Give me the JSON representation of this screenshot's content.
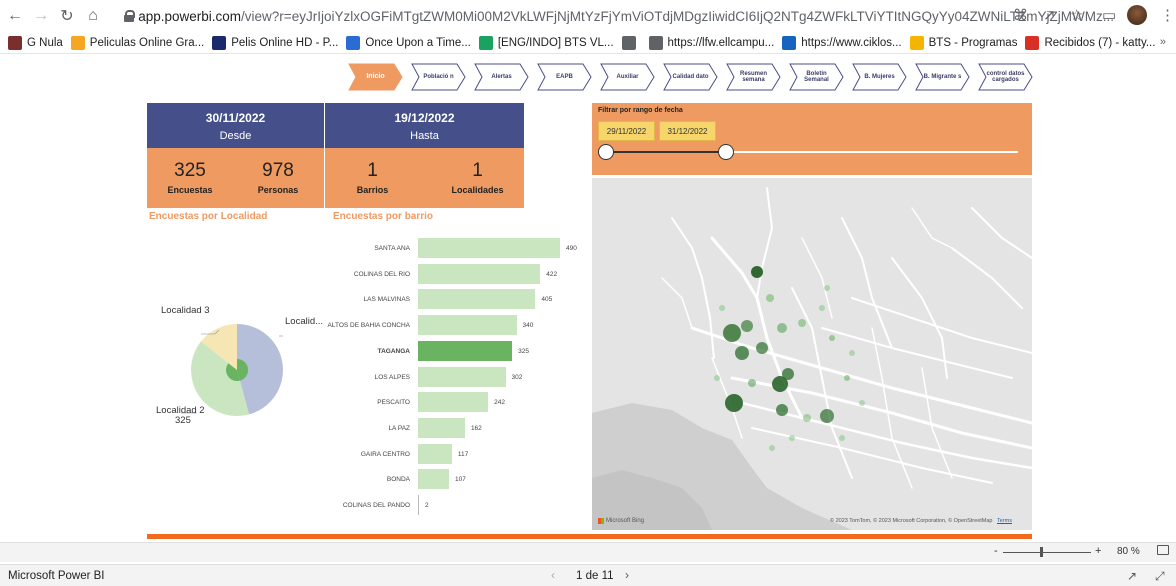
{
  "browser": {
    "url_host": "app.powerbi.com",
    "url_path": "/view?r=eyJrIjoiYzlxOGFiMTgtZWM0Mi00M2VkLWFjNjMtYzFjYmViOTdjMDgzIiwidCI6IjQ2NTg4ZWFkLTViYTItNGQyYy04ZWNiLTZmYjZjMWMz...",
    "bookmarks": [
      {
        "label": "G Nula",
        "icon": "gnula-icon",
        "color": "#7a2e2e"
      },
      {
        "label": "Peliculas Online Gra...",
        "icon": "88-icon",
        "color": "#f5a623"
      },
      {
        "label": "Pelis Online HD - P...",
        "icon": "hd-icon",
        "color": "#1a2a6c"
      },
      {
        "label": "Once Upon a Time...",
        "icon": "s-icon",
        "color": "#2b6cd4"
      },
      {
        "label": "[ENG/INDO] BTS VL...",
        "icon": "plus-icon",
        "color": "#1aa260"
      },
      {
        "label": "",
        "icon": "globe-icon",
        "color": "#5f6368"
      },
      {
        "label": "https://lfw.ellcampu...",
        "icon": "globe-icon",
        "color": "#5f6368"
      },
      {
        "label": "https://www.ciklos...",
        "icon": "c-icon",
        "color": "#1565c0"
      },
      {
        "label": "BTS - Programas",
        "icon": "drive-icon",
        "color": "#f4b400"
      },
      {
        "label": "Recibidos (7) - katty...",
        "icon": "gmail-icon",
        "color": "#d93025"
      }
    ]
  },
  "nav": [
    {
      "label": "Inicio",
      "active": true
    },
    {
      "label": "Població n",
      "active": false
    },
    {
      "label": "Alertas",
      "active": false
    },
    {
      "label": "EAPB",
      "active": false
    },
    {
      "label": "Auxiliar",
      "active": false
    },
    {
      "label": "Calidad dato",
      "active": false
    },
    {
      "label": "Resumen semana",
      "active": false
    },
    {
      "label": "Boletin Semanal",
      "active": false
    },
    {
      "label": "B. Mujeres",
      "active": false
    },
    {
      "label": "B. Migrante s",
      "active": false
    },
    {
      "label": "control datos cargados",
      "active": false
    }
  ],
  "kpi": {
    "desde_date": "30/11/2022",
    "desde_label": "Desde",
    "hasta_date": "19/12/2022",
    "hasta_label": "Hasta",
    "encuestas_value": "325",
    "encuestas_label": "Encuestas",
    "personas_value": "978",
    "personas_label": "Personas",
    "barrios_value": "1",
    "barrios_label": "Barrios",
    "localidades_value": "1",
    "localidades_label": "Localidades"
  },
  "filter": {
    "title": "Filtrar por rango de fecha",
    "start": "29/11/2022",
    "end": "31/12/2022"
  },
  "sections": {
    "pie_title": "Encuestas por Localidad",
    "bar_title": "Encuestas por barrio"
  },
  "pie": {
    "labels": {
      "loc3": "Localidad 3",
      "loc1": "Localid...",
      "loc2": "Localidad 2",
      "loc2_value": "325"
    }
  },
  "chart_data": {
    "type": "bar",
    "orientation": "horizontal",
    "title": "Encuestas por barrio",
    "categories": [
      "SANTA ANA",
      "COLINAS DEL RIO",
      "LAS MALVINAS",
      "ALTOS DE BAHIA CONCHA",
      "TAGANGA",
      "LOS ALPES",
      "PESCAITO",
      "LA PAZ",
      "GAIRA CENTRO",
      "BONDA",
      "COLINAS DEL PANDO"
    ],
    "values": [
      490,
      422,
      405,
      340,
      325,
      302,
      242,
      162,
      117,
      107,
      2
    ],
    "highlighted": "TAGANGA",
    "colors": {
      "normal": "#c9e6c0",
      "highlight": "#6ab461"
    }
  },
  "map": {
    "attribution": "© 2023 TomTom, © 2023 Microsoft Corporation, © OpenStreetMap",
    "terms": "Terms",
    "logo": "Microsoft Bing"
  },
  "status": {
    "zoom": "80 %",
    "zoom_minus": "-",
    "zoom_plus": "+"
  },
  "footer": {
    "app_name": "Microsoft Power BI",
    "page_indicator": "1 de 11"
  }
}
